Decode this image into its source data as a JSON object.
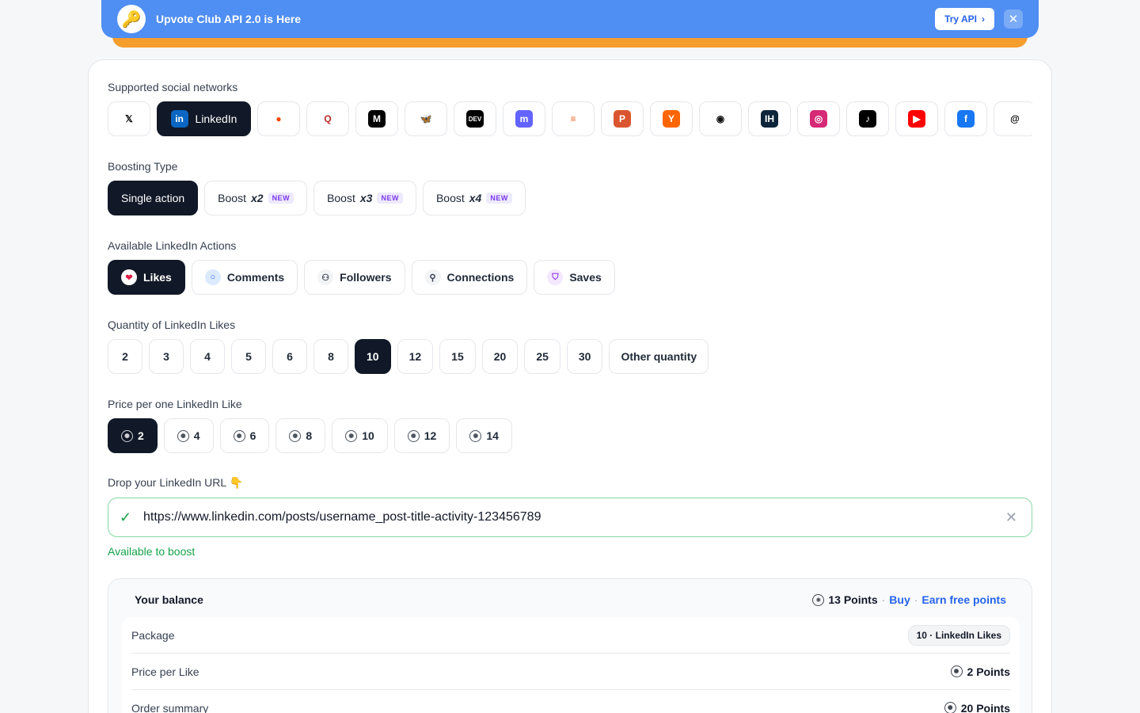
{
  "banner": {
    "logo_emoji": "🔑",
    "title": "Upvote Club API 2.0 is Here",
    "cta_label": "Try API",
    "cta_chevron": "›",
    "close_symbol": "✕",
    "color": "#4f8ef3"
  },
  "networks": {
    "label": "Supported social networks",
    "items": [
      {
        "id": "x",
        "icon": "x-icon",
        "glyph": "𝕏",
        "fg": "#000000",
        "bg": "#ffffff"
      },
      {
        "id": "linkedin",
        "icon": "linkedin-icon",
        "glyph": "in",
        "label": "LinkedIn",
        "fg": "#ffffff",
        "bg": "#0a66c2"
      },
      {
        "id": "reddit",
        "icon": "reddit-icon",
        "glyph": "●",
        "fg": "#ff4500",
        "bg": "#ffffff"
      },
      {
        "id": "quora",
        "icon": "quora-icon",
        "glyph": "Q",
        "fg": "#b92b27",
        "bg": "#ffffff"
      },
      {
        "id": "medium",
        "icon": "medium-icon",
        "glyph": "M",
        "fg": "#ffffff",
        "bg": "#000000"
      },
      {
        "id": "bluesky",
        "icon": "bluesky-icon",
        "glyph": "🦋",
        "fg": "#1185fe",
        "bg": "#ffffff"
      },
      {
        "id": "devto",
        "icon": "devto-icon",
        "glyph": "DEV",
        "fg": "#ffffff",
        "bg": "#000000"
      },
      {
        "id": "mastodon",
        "icon": "mastodon-icon",
        "glyph": "m",
        "fg": "#ffffff",
        "bg": "#6364ff"
      },
      {
        "id": "hashnode",
        "icon": "hashnode-icon",
        "glyph": "≡",
        "fg": "#f0682a",
        "bg": "#ffffff"
      },
      {
        "id": "producthunt",
        "icon": "producthunt-icon",
        "glyph": "P",
        "fg": "#ffffff",
        "bg": "#da552f"
      },
      {
        "id": "hackernews",
        "icon": "hackernews-icon",
        "glyph": "Y",
        "fg": "#ffffff",
        "bg": "#ff6600"
      },
      {
        "id": "github",
        "icon": "github-icon",
        "glyph": "◉",
        "fg": "#111111",
        "bg": "#ffffff"
      },
      {
        "id": "indiehackers",
        "icon": "indiehackers-icon",
        "glyph": "IH",
        "fg": "#ffffff",
        "bg": "#0e2439"
      },
      {
        "id": "instagram",
        "icon": "instagram-icon",
        "glyph": "◎",
        "fg": "#ffffff",
        "bg": "#d62976"
      },
      {
        "id": "tiktok",
        "icon": "tiktok-icon",
        "glyph": "♪",
        "fg": "#ffffff",
        "bg": "#000000"
      },
      {
        "id": "youtube",
        "icon": "youtube-icon",
        "glyph": "▶",
        "fg": "#ffffff",
        "bg": "#ff0000"
      },
      {
        "id": "facebook",
        "icon": "facebook-icon",
        "glyph": "f",
        "fg": "#ffffff",
        "bg": "#1877f2"
      },
      {
        "id": "threads",
        "icon": "threads-icon",
        "glyph": "@",
        "fg": "#000000",
        "bg": "#ffffff"
      }
    ]
  },
  "boosting": {
    "label": "Boosting Type",
    "options": [
      {
        "label": "Single action",
        "active": true
      },
      {
        "label": "Boost",
        "mult": "x2",
        "badge": "NEW"
      },
      {
        "label": "Boost",
        "mult": "x3",
        "badge": "NEW"
      },
      {
        "label": "Boost",
        "mult": "x4",
        "badge": "NEW"
      }
    ]
  },
  "actions": {
    "label": "Available LinkedIn Actions",
    "items": [
      {
        "label": "Likes",
        "icon": "heart-icon",
        "glyph": "❤",
        "fg": "#e11d48",
        "bg": "#ffe4e6",
        "active": true
      },
      {
        "label": "Comments",
        "icon": "comment-icon",
        "glyph": "○",
        "fg": "#2563eb",
        "bg": "#dbeafe"
      },
      {
        "label": "Followers",
        "icon": "user-plus-icon",
        "glyph": "⚇",
        "fg": "#374151",
        "bg": "#f3f4f6"
      },
      {
        "label": "Connections",
        "icon": "user-icon",
        "glyph": "⚲",
        "fg": "#374151",
        "bg": "#f3f4f6"
      },
      {
        "label": "Saves",
        "icon": "bookmark-icon",
        "glyph": "⛉",
        "fg": "#9333ea",
        "bg": "#f3e8ff"
      }
    ]
  },
  "quantity": {
    "label": "Quantity of LinkedIn Likes",
    "options": [
      "2",
      "3",
      "4",
      "5",
      "6",
      "8",
      "10",
      "12",
      "15",
      "20",
      "25",
      "30",
      "Other quantity"
    ],
    "selected": "10"
  },
  "price": {
    "label": "Price per one LinkedIn Like",
    "options": [
      "2",
      "4",
      "6",
      "8",
      "10",
      "12",
      "14"
    ],
    "selected": "2"
  },
  "url": {
    "label": "Drop your LinkedIn URL 👇",
    "value": "https://www.linkedin.com/posts/username_post-title-activity-123456789",
    "check_symbol": "✓",
    "clear_symbol": "✕",
    "status": "Available to boost"
  },
  "balance": {
    "title": "Your balance",
    "points": "13 Points",
    "sep": "·",
    "buy_label": "Buy",
    "earn_label": "Earn free points",
    "rows": [
      {
        "label": "Package",
        "value": "10 · LinkedIn Likes",
        "type": "badge"
      },
      {
        "label": "Price per Like",
        "value": "2 Points",
        "type": "coin"
      },
      {
        "label": "Order summary",
        "value": "20 Points",
        "type": "coin"
      }
    ]
  }
}
